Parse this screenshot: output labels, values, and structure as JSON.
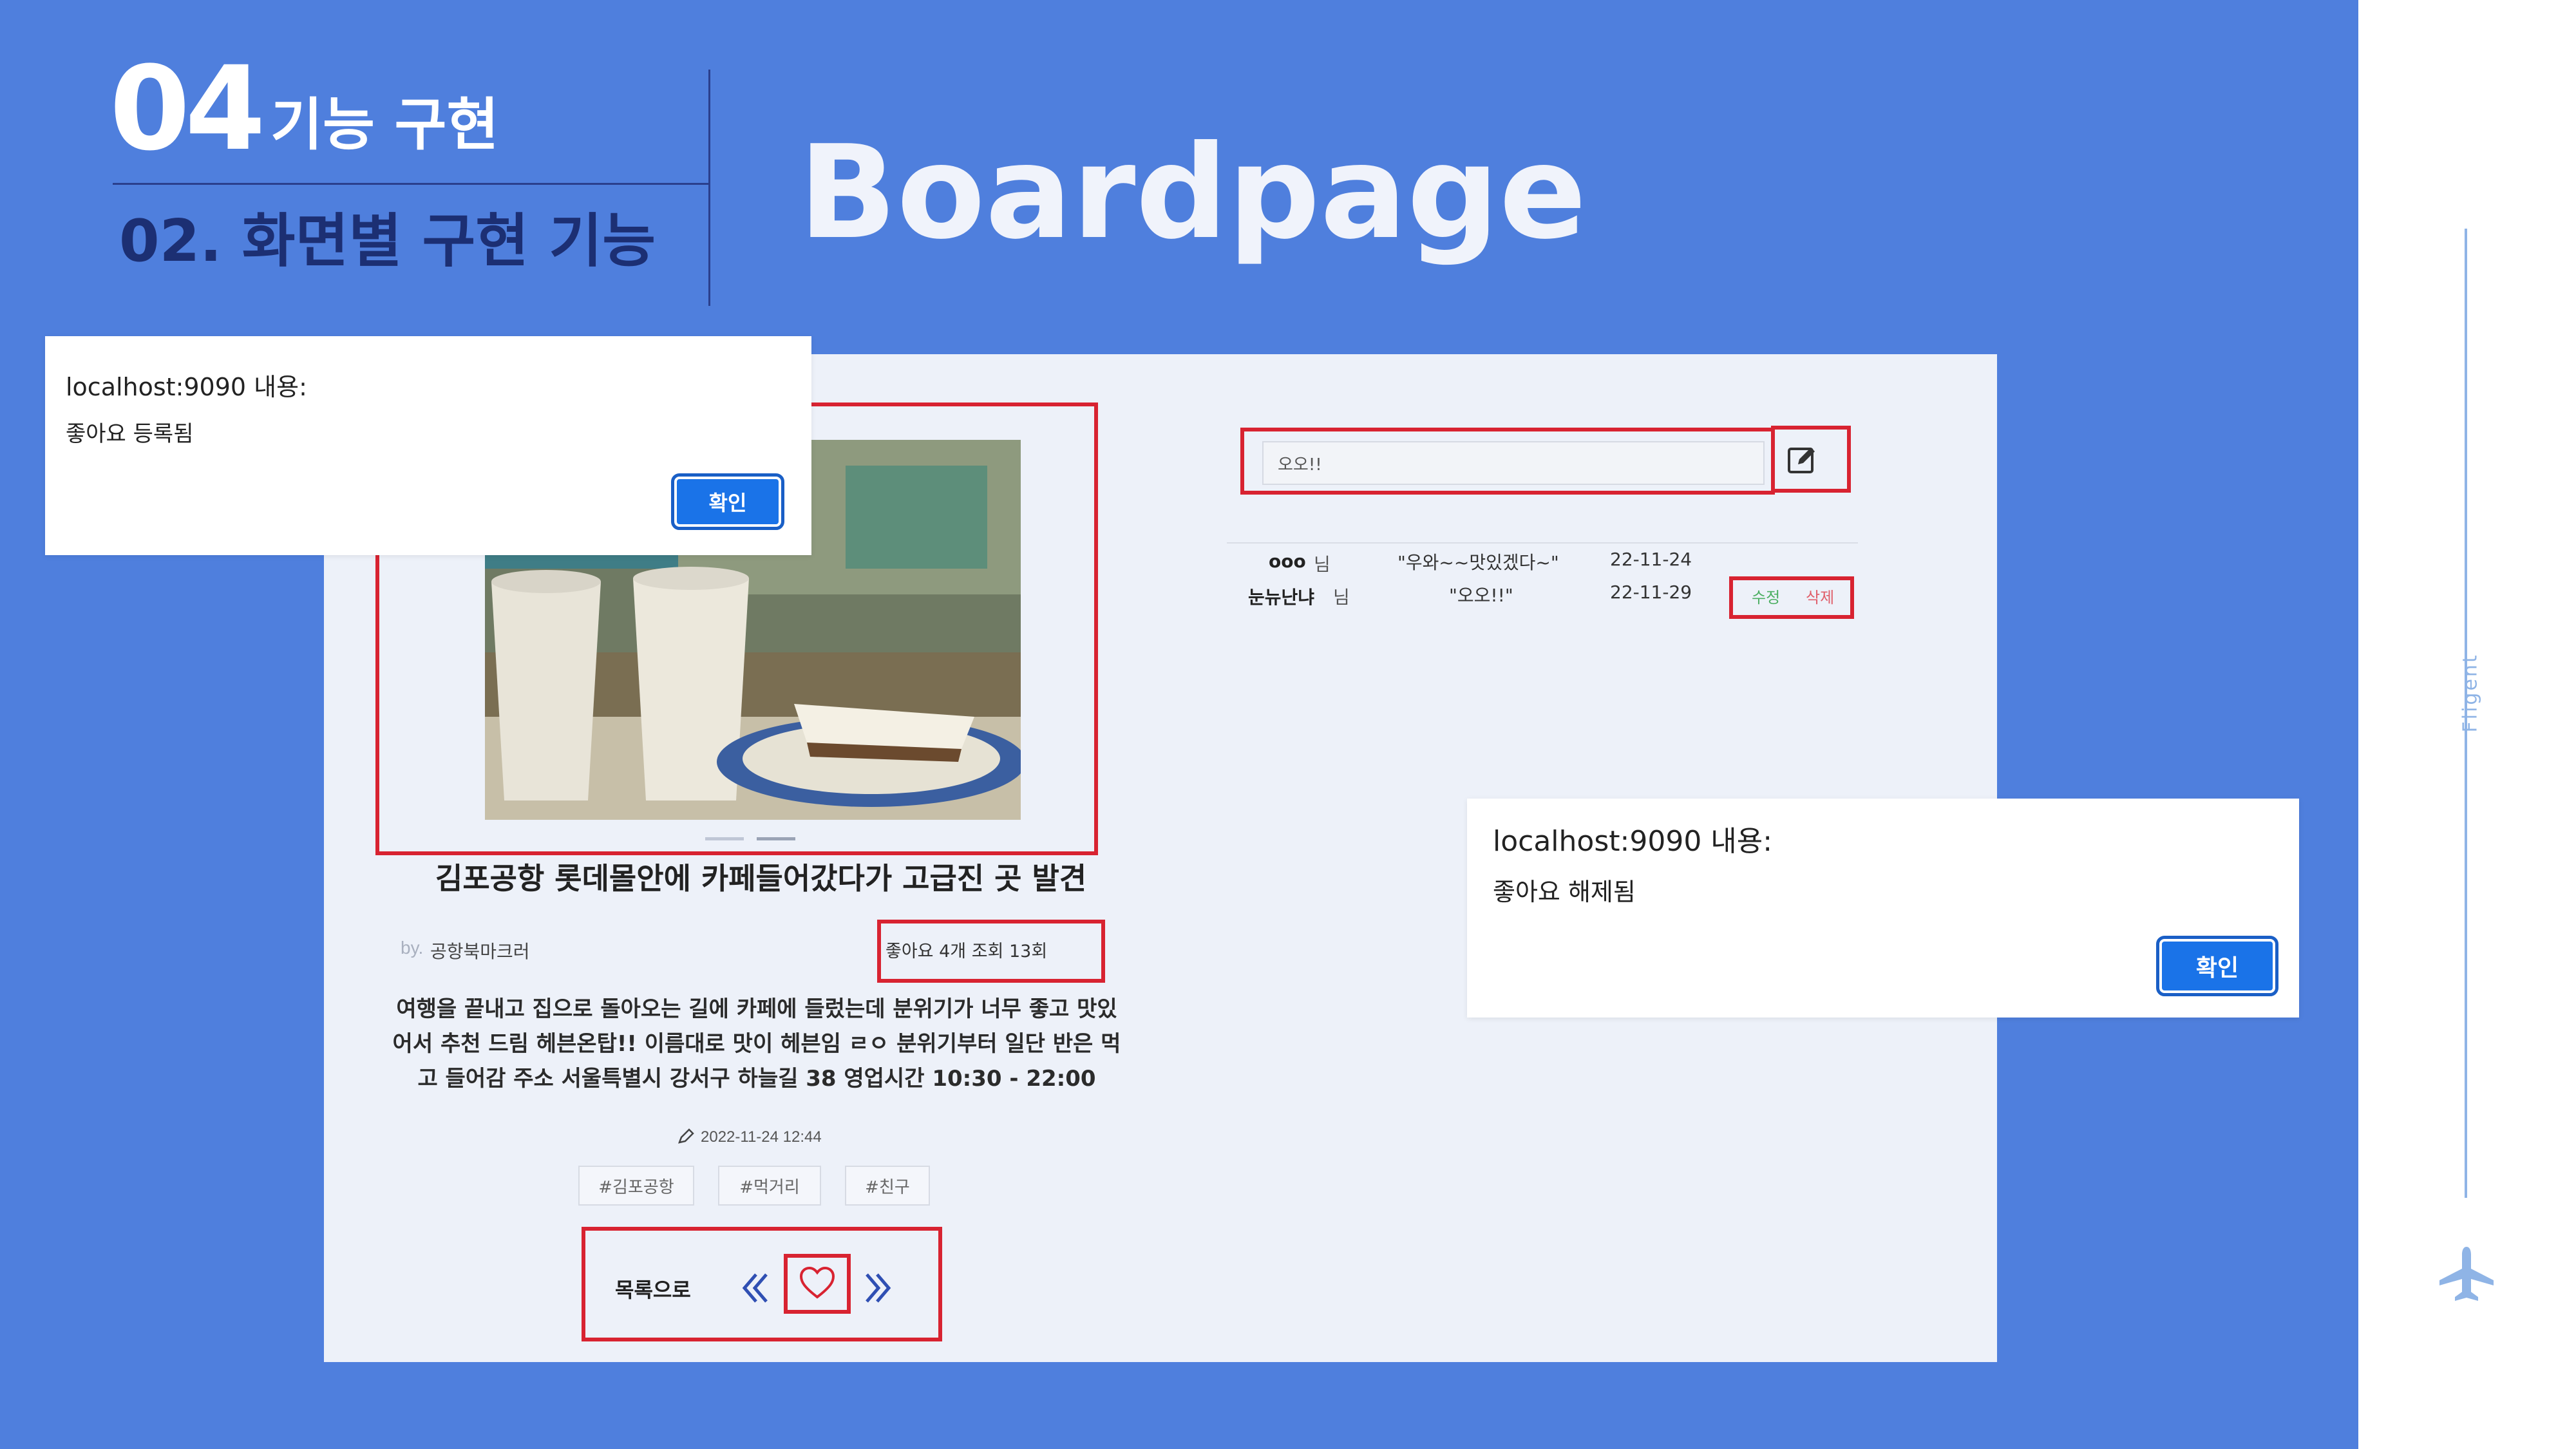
{
  "header": {
    "section_number": "04",
    "section_title": "기능 구현",
    "sub_title": "02. 화면별 구현 기능",
    "page_title": "Boardpage"
  },
  "sidebar": {
    "brand": "Fligent",
    "icon": "airplane-icon",
    "line_color": "#8fb4e6"
  },
  "colors": {
    "slide_background": "#4f7fdd",
    "highlight_red": "#d82331",
    "dialog_button": "#1a73e8"
  },
  "post": {
    "title": "김포공항 롯데몰안에 카페들어갔다가 고급진 곳 발견",
    "by_label": "by.",
    "author": "공항북마크러",
    "stats": "좋아요 4개  조회 13회",
    "body": "여행을 끝내고 집으로 돌아오는 길에 카페에 들렀는데 분위기가 너무 좋고 맛있어서 추천 드림 헤븐온탑!! 이름대로 맛이 헤븐임 ㄹㅇ 분위기부터 일단 반은 먹고 들어감 주소 서울특별시 강서구 하늘길 38 영업시간 10:30 - 22:00",
    "date_icon": "pen-icon",
    "date": "2022-11-24 12:44",
    "tags": [
      "#김포공항",
      "#먹거리",
      "#친구"
    ],
    "list_link": "목록으로"
  },
  "comments": {
    "input_value": "오오!!",
    "submit_icon": "edit-icon",
    "items": [
      {
        "name": "ooo",
        "suffix": "님",
        "text": "\"우와~~맛있겠다~\"",
        "date": "22-11-24"
      },
      {
        "name": "눈뉴난냐",
        "suffix": "님",
        "text": "\"오오!!\"",
        "date": "22-11-29",
        "edit_label": "수정",
        "delete_label": "삭제"
      }
    ]
  },
  "dialogs": {
    "like_added": {
      "title": "localhost:9090 내용:",
      "message": "좋아요 등록됨",
      "button": "확인"
    },
    "like_removed": {
      "title": "localhost:9090 내용:",
      "message": "좋아요 해제됨",
      "button": "확인"
    }
  }
}
